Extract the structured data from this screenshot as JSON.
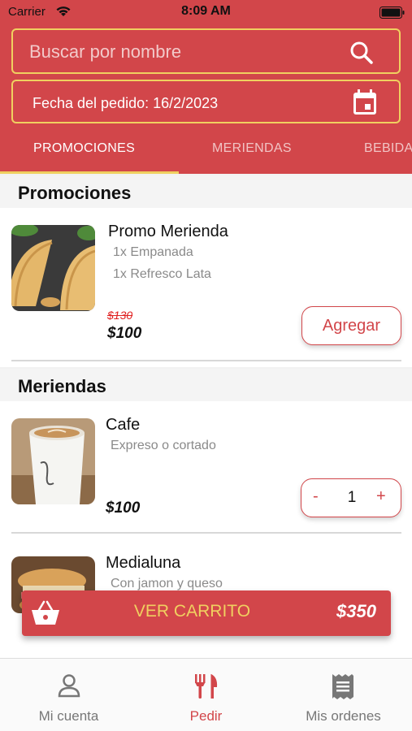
{
  "status_bar": {
    "carrier": "Carrier",
    "time": "8:09 AM"
  },
  "search": {
    "placeholder": "Buscar por nombre",
    "value": ""
  },
  "date_filter": {
    "label": "Fecha del pedido: 16/2/2023"
  },
  "tabs": [
    {
      "label": "PROMOCIONES",
      "active": true
    },
    {
      "label": "MERIENDAS",
      "active": false
    },
    {
      "label": "BEBIDAS",
      "active": false
    }
  ],
  "sections": {
    "promociones": {
      "title": "Promociones",
      "item": {
        "name": "Promo Merienda",
        "desc1": "1x Empanada",
        "desc2": "1x Refresco Lata",
        "old_price": "$130",
        "price": "$100",
        "button": "Agregar"
      }
    },
    "meriendas": {
      "title": "Meriendas",
      "items": [
        {
          "name": "Cafe",
          "desc": "Expreso o cortado",
          "price": "$100",
          "quantity": "1",
          "minus": "-",
          "plus": "+"
        },
        {
          "name": "Medialuna",
          "desc": "Con jamon y queso"
        }
      ]
    }
  },
  "cart": {
    "label": "VER CARRITO",
    "total": "$350"
  },
  "bottom_nav": [
    {
      "label": "Mi cuenta",
      "icon": "user-icon",
      "active": false
    },
    {
      "label": "Pedir",
      "icon": "fork-knife-icon",
      "active": true
    },
    {
      "label": "Mis ordenes",
      "icon": "receipt-icon",
      "active": false
    }
  ],
  "colors": {
    "primary": "#d2464a",
    "accent": "#f0d060",
    "text": "#111111",
    "muted": "#8a8a8a"
  }
}
